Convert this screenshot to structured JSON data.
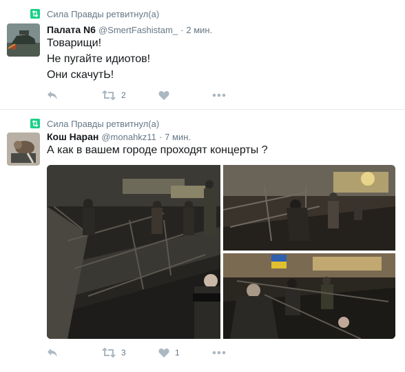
{
  "tweets": [
    {
      "retweet_text": "Сила Правды ретвитнул(а)",
      "name": "Палата N6",
      "handle": "@SmertFashistam_",
      "dot": "·",
      "time": "2 мин.",
      "lines": [
        "Товарищи!",
        "Не пугайте идиотов!",
        "Они скачутЬ!"
      ],
      "retweets": "2",
      "likes": ""
    },
    {
      "retweet_text": "Сила Правды ретвитнул(а)",
      "name": "Кош Наран",
      "handle": "@monahkz11",
      "dot": "·",
      "time": "7 мин.",
      "lines": [
        "А как в вашем городе проходят концерты ?"
      ],
      "retweets": "3",
      "likes": "1"
    }
  ],
  "icons": {
    "retweet": "retweet-icon",
    "reply": "reply-icon",
    "like": "heart-icon",
    "more": "more-icon"
  },
  "colors": {
    "retweet_green": "#19cf86",
    "icon_gray": "#aab8c2",
    "meta_gray": "#657786",
    "divider": "#e6ecf0"
  }
}
